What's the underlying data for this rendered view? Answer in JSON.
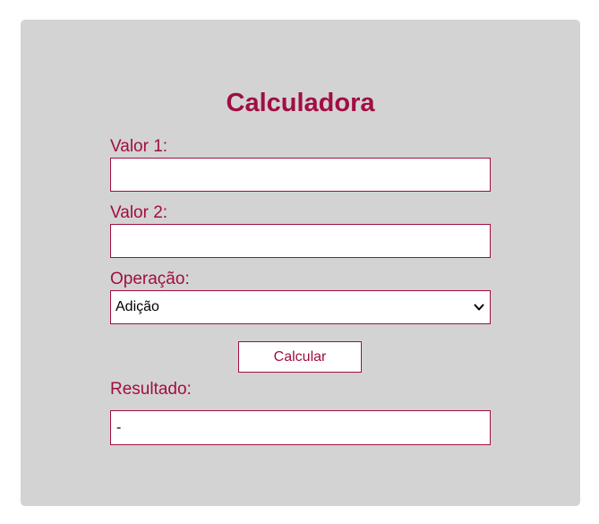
{
  "calculator": {
    "title": "Calculadora",
    "value1_label": "Valor 1:",
    "value1_input": "",
    "value2_label": "Valor 2:",
    "value2_input": "",
    "operation_label": "Operação:",
    "operation_selected": "Adição",
    "calculate_button": "Calcular",
    "result_label": "Resultado:",
    "result_value": "-"
  },
  "colors": {
    "accent": "#a00e43",
    "card_background": "#d3d3d3",
    "field_background": "#ffffff"
  }
}
